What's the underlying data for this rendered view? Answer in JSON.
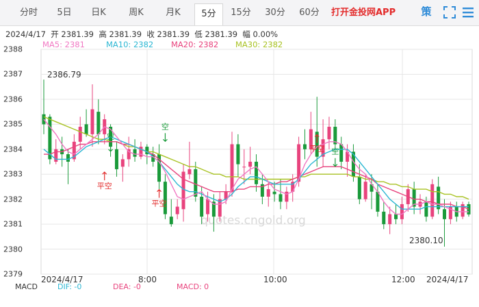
{
  "tabs": [
    "分时",
    "5日",
    "日K",
    "周K",
    "月K",
    "5分",
    "15分",
    "30分",
    "60分"
  ],
  "active_tab": 5,
  "promo": "打开金投网APP",
  "ce_icon": "策",
  "info": {
    "date": "2024/4/17",
    "open": "开 2381.39",
    "high": "高 2381.39",
    "close": "收 2381.39",
    "low": "低 2381.39",
    "amp": "幅 0.00%"
  },
  "ma_legend": [
    {
      "text": "MA5: 2381",
      "color": "#f178c3"
    },
    {
      "text": "MA10: 2382",
      "color": "#2cb7d3"
    },
    {
      "text": "MA20: 2382",
      "color": "#e8437d"
    },
    {
      "text": "MA30: 2382",
      "color": "#a8c222"
    }
  ],
  "bottom": {
    "macd": "MACD",
    "dif_label": "DIF: -0",
    "dea_label": "DEA: -0",
    "macd_label": "MACD: 0"
  },
  "chart_data": {
    "type": "candlestick",
    "ylim": [
      2379,
      2388
    ],
    "y_ticks": [
      2379,
      2380,
      2381,
      2382,
      2383,
      2384,
      2385,
      2386,
      2387,
      2388
    ],
    "x_labels": [
      "2024/4/17",
      "8:00",
      "10:00",
      "12:00",
      "2024/4/17"
    ],
    "annotations": {
      "max_label": "2386.79",
      "min_label": "2380.10",
      "marks": [
        "平空",
        "空",
        "平空",
        "空",
        "平空",
        "空"
      ]
    },
    "watermark": "quotes.cngold.org",
    "colors": {
      "up": "#e8437d",
      "down": "#1a9a3a"
    },
    "candles": [
      {
        "o": 2385.4,
        "h": 2386.79,
        "l": 2384.6,
        "c": 2385.0
      },
      {
        "o": 2385.3,
        "h": 2385.4,
        "l": 2383.4,
        "c": 2383.6
      },
      {
        "o": 2383.5,
        "h": 2384.4,
        "l": 2383.4,
        "c": 2384.0
      },
      {
        "o": 2384.0,
        "h": 2384.5,
        "l": 2383.3,
        "c": 2383.8
      },
      {
        "o": 2383.8,
        "h": 2384.0,
        "l": 2382.6,
        "c": 2383.5
      },
      {
        "o": 2383.6,
        "h": 2384.6,
        "l": 2383.5,
        "c": 2384.3
      },
      {
        "o": 2384.3,
        "h": 2385.3,
        "l": 2384.0,
        "c": 2384.9
      },
      {
        "o": 2385.0,
        "h": 2385.6,
        "l": 2384.5,
        "c": 2384.6
      },
      {
        "o": 2384.6,
        "h": 2386.6,
        "l": 2384.1,
        "c": 2385.6
      },
      {
        "o": 2385.5,
        "h": 2386.0,
        "l": 2384.2,
        "c": 2384.6
      },
      {
        "o": 2384.6,
        "h": 2385.4,
        "l": 2384.2,
        "c": 2385.2
      },
      {
        "o": 2384.9,
        "h": 2385.0,
        "l": 2383.7,
        "c": 2384.1
      },
      {
        "o": 2384.0,
        "h": 2384.3,
        "l": 2382.9,
        "c": 2383.2
      },
      {
        "o": 2383.3,
        "h": 2383.8,
        "l": 2382.7,
        "c": 2383.6
      },
      {
        "o": 2383.6,
        "h": 2384.5,
        "l": 2383.3,
        "c": 2384.0
      },
      {
        "o": 2384.0,
        "h": 2384.4,
        "l": 2383.5,
        "c": 2383.7
      },
      {
        "o": 2383.7,
        "h": 2384.3,
        "l": 2383.6,
        "c": 2384.1
      },
      {
        "o": 2384.1,
        "h": 2384.2,
        "l": 2383.4,
        "c": 2383.8
      },
      {
        "o": 2383.8,
        "h": 2384.1,
        "l": 2383.3,
        "c": 2383.5
      },
      {
        "o": 2383.8,
        "h": 2384.2,
        "l": 2382.4,
        "c": 2382.7
      },
      {
        "o": 2382.7,
        "h": 2383.0,
        "l": 2381.2,
        "c": 2381.4
      },
      {
        "o": 2381.3,
        "h": 2382.0,
        "l": 2380.9,
        "c": 2381.0
      },
      {
        "o": 2381.4,
        "h": 2382.0,
        "l": 2381.2,
        "c": 2381.7
      },
      {
        "o": 2381.6,
        "h": 2383.4,
        "l": 2381.1,
        "c": 2383.1
      },
      {
        "o": 2383.0,
        "h": 2384.3,
        "l": 2382.8,
        "c": 2383.2
      },
      {
        "o": 2383.2,
        "h": 2383.5,
        "l": 2381.9,
        "c": 2382.1
      },
      {
        "o": 2382.1,
        "h": 2382.5,
        "l": 2381.0,
        "c": 2381.3
      },
      {
        "o": 2381.4,
        "h": 2382.3,
        "l": 2381.1,
        "c": 2382.0
      },
      {
        "o": 2381.9,
        "h": 2382.2,
        "l": 2380.7,
        "c": 2381.3
      },
      {
        "o": 2381.3,
        "h": 2382.3,
        "l": 2381.1,
        "c": 2382.0
      },
      {
        "o": 2382.0,
        "h": 2382.6,
        "l": 2381.8,
        "c": 2382.3
      },
      {
        "o": 2382.3,
        "h": 2384.7,
        "l": 2382.1,
        "c": 2384.2
      },
      {
        "o": 2384.2,
        "h": 2384.6,
        "l": 2382.9,
        "c": 2383.4
      },
      {
        "o": 2383.3,
        "h": 2384.0,
        "l": 2382.6,
        "c": 2383.3
      },
      {
        "o": 2383.3,
        "h": 2384.1,
        "l": 2383.0,
        "c": 2383.5
      },
      {
        "o": 2383.5,
        "h": 2383.8,
        "l": 2382.3,
        "c": 2382.6
      },
      {
        "o": 2382.6,
        "h": 2383.0,
        "l": 2381.8,
        "c": 2382.1
      },
      {
        "o": 2382.1,
        "h": 2382.7,
        "l": 2381.7,
        "c": 2382.4
      },
      {
        "o": 2382.3,
        "h": 2382.7,
        "l": 2381.9,
        "c": 2382.2
      },
      {
        "o": 2382.2,
        "h": 2382.8,
        "l": 2381.6,
        "c": 2381.9
      },
      {
        "o": 2381.9,
        "h": 2382.5,
        "l": 2381.6,
        "c": 2382.3
      },
      {
        "o": 2382.3,
        "h": 2383.0,
        "l": 2381.9,
        "c": 2382.7
      },
      {
        "o": 2382.7,
        "h": 2384.5,
        "l": 2382.5,
        "c": 2384.2
      },
      {
        "o": 2384.2,
        "h": 2384.8,
        "l": 2383.6,
        "c": 2384.0
      },
      {
        "o": 2384.0,
        "h": 2385.5,
        "l": 2383.8,
        "c": 2384.8
      },
      {
        "o": 2384.7,
        "h": 2386.1,
        "l": 2383.3,
        "c": 2383.7
      },
      {
        "o": 2383.7,
        "h": 2385.2,
        "l": 2383.3,
        "c": 2384.4
      },
      {
        "o": 2384.4,
        "h": 2385.3,
        "l": 2384.0,
        "c": 2384.9
      },
      {
        "o": 2384.9,
        "h": 2385.2,
        "l": 2383.9,
        "c": 2384.2
      },
      {
        "o": 2384.2,
        "h": 2384.5,
        "l": 2383.2,
        "c": 2383.5
      },
      {
        "o": 2383.5,
        "h": 2384.2,
        "l": 2382.9,
        "c": 2383.9
      },
      {
        "o": 2383.9,
        "h": 2384.2,
        "l": 2382.7,
        "c": 2382.9
      },
      {
        "o": 2382.9,
        "h": 2383.4,
        "l": 2381.8,
        "c": 2382.0
      },
      {
        "o": 2382.0,
        "h": 2383.0,
        "l": 2381.9,
        "c": 2382.7
      },
      {
        "o": 2382.6,
        "h": 2383.0,
        "l": 2381.6,
        "c": 2382.3
      },
      {
        "o": 2382.3,
        "h": 2382.6,
        "l": 2381.3,
        "c": 2381.5
      },
      {
        "o": 2381.5,
        "h": 2381.9,
        "l": 2380.8,
        "c": 2381.0
      },
      {
        "o": 2381.0,
        "h": 2381.7,
        "l": 2380.6,
        "c": 2381.4
      },
      {
        "o": 2381.4,
        "h": 2381.8,
        "l": 2381.0,
        "c": 2381.2
      },
      {
        "o": 2381.2,
        "h": 2382.1,
        "l": 2381.0,
        "c": 2381.8
      },
      {
        "o": 2381.8,
        "h": 2382.6,
        "l": 2381.5,
        "c": 2382.4
      },
      {
        "o": 2382.4,
        "h": 2382.7,
        "l": 2381.4,
        "c": 2381.7
      },
      {
        "o": 2381.7,
        "h": 2382.2,
        "l": 2381.4,
        "c": 2381.9
      },
      {
        "o": 2381.9,
        "h": 2382.1,
        "l": 2381.1,
        "c": 2381.3
      },
      {
        "o": 2381.3,
        "h": 2382.8,
        "l": 2381.2,
        "c": 2382.6
      },
      {
        "o": 2382.5,
        "h": 2382.9,
        "l": 2381.4,
        "c": 2381.6
      },
      {
        "o": 2381.6,
        "h": 2382.0,
        "l": 2380.1,
        "c": 2381.2
      },
      {
        "o": 2381.2,
        "h": 2381.9,
        "l": 2381.0,
        "c": 2381.7
      },
      {
        "o": 2381.7,
        "h": 2381.9,
        "l": 2381.1,
        "c": 2381.3
      },
      {
        "o": 2381.3,
        "h": 2381.9,
        "l": 2381.2,
        "c": 2381.8
      },
      {
        "o": 2381.8,
        "h": 2381.9,
        "l": 2381.3,
        "c": 2381.39
      }
    ],
    "ma5": [
      2385.2,
      2384.9,
      2384.6,
      2384.2,
      2383.9,
      2383.8,
      2384.0,
      2384.2,
      2384.4,
      2384.6,
      2384.9,
      2384.8,
      2384.5,
      2384.2,
      2383.9,
      2383.8,
      2383.8,
      2383.7,
      2383.7,
      2383.5,
      2383.1,
      2382.6,
      2382.1,
      2382.0,
      2382.1,
      2382.2,
      2382.3,
      2382.0,
      2381.8,
      2381.8,
      2381.9,
      2382.4,
      2382.8,
      2383.0,
      2383.2,
      2383.3,
      2383.0,
      2382.7,
      2382.4,
      2382.3,
      2382.2,
      2382.3,
      2382.8,
      2383.4,
      2383.8,
      2384.1,
      2384.2,
      2384.3,
      2384.3,
      2384.2,
      2383.9,
      2383.5,
      2383.2,
      2383.0,
      2382.6,
      2382.3,
      2381.9,
      2381.6,
      2381.4,
      2381.4,
      2381.6,
      2381.8,
      2381.8,
      2381.9,
      2381.8,
      2381.8,
      2381.7,
      2381.6,
      2381.5,
      2381.5,
      2381.5
    ],
    "ma10": [
      2384.0,
      2383.8,
      2383.6,
      2383.6,
      2383.6,
      2383.7,
      2383.9,
      2384.1,
      2384.2,
      2384.3,
      2384.4,
      2384.5,
      2384.4,
      2384.3,
      2384.2,
      2384.1,
      2384.0,
      2383.9,
      2383.7,
      2383.5,
      2383.2,
      2382.9,
      2382.6,
      2382.4,
      2382.3,
      2382.3,
      2382.2,
      2382.1,
      2382.0,
      2381.9,
      2382.0,
      2382.2,
      2382.5,
      2382.7,
      2382.9,
      2382.9,
      2382.8,
      2382.7,
      2382.6,
      2382.6,
      2382.6,
      2382.6,
      2382.8,
      2383.1,
      2383.4,
      2383.6,
      2383.8,
      2383.9,
      2384.0,
      2384.0,
      2384.0,
      2383.8,
      2383.5,
      2383.2,
      2382.9,
      2382.6,
      2382.3,
      2382.0,
      2381.8,
      2381.6,
      2381.6,
      2381.6,
      2381.6,
      2381.7,
      2381.7,
      2381.7,
      2381.7,
      2381.7,
      2381.7,
      2381.7,
      2381.7
    ],
    "ma20": [
      2383.8,
      2383.8,
      2383.9,
      2383.9,
      2384.0,
      2384.1,
      2384.2,
      2384.2,
      2384.3,
      2384.3,
      2384.3,
      2384.3,
      2384.3,
      2384.2,
      2384.2,
      2384.1,
      2384.0,
      2383.9,
      2383.8,
      2383.6,
      2383.4,
      2383.2,
      2383.0,
      2382.8,
      2382.7,
      2382.6,
      2382.5,
      2382.4,
      2382.3,
      2382.3,
      2382.3,
      2382.3,
      2382.4,
      2382.4,
      2382.5,
      2382.5,
      2382.5,
      2382.6,
      2382.6,
      2382.7,
      2382.7,
      2382.8,
      2382.9,
      2383.0,
      2383.1,
      2383.2,
      2383.3,
      2383.3,
      2383.3,
      2383.3,
      2383.2,
      2383.1,
      2383.0,
      2382.9,
      2382.8,
      2382.6,
      2382.5,
      2382.4,
      2382.3,
      2382.2,
      2382.1,
      2382.0,
      2382.0,
      2381.9,
      2381.9,
      2381.8,
      2381.8,
      2381.8,
      2381.7,
      2381.7,
      2381.6
    ],
    "ma30": [
      2385.3,
      2385.2,
      2385.1,
      2385.0,
      2384.9,
      2384.8,
      2384.7,
      2384.6,
      2384.5,
      2384.4,
      2384.4,
      2384.3,
      2384.3,
      2384.2,
      2384.1,
      2384.1,
      2384.0,
      2383.9,
      2383.9,
      2383.8,
      2383.7,
      2383.6,
      2383.5,
      2383.4,
      2383.3,
      2383.3,
      2383.2,
      2383.1,
      2383.0,
      2383.0,
      2382.9,
      2382.9,
      2382.9,
      2382.8,
      2382.8,
      2382.8,
      2382.8,
      2382.8,
      2382.8,
      2382.8,
      2382.8,
      2382.8,
      2382.9,
      2382.9,
      2383.0,
      2383.0,
      2383.0,
      2383.0,
      2383.0,
      2383.0,
      2383.0,
      2382.9,
      2382.9,
      2382.8,
      2382.8,
      2382.7,
      2382.7,
      2382.6,
      2382.6,
      2382.5,
      2382.5,
      2382.4,
      2382.4,
      2382.4,
      2382.3,
      2382.3,
      2382.2,
      2382.2,
      2382.1,
      2382.1,
      2382.0
    ]
  }
}
